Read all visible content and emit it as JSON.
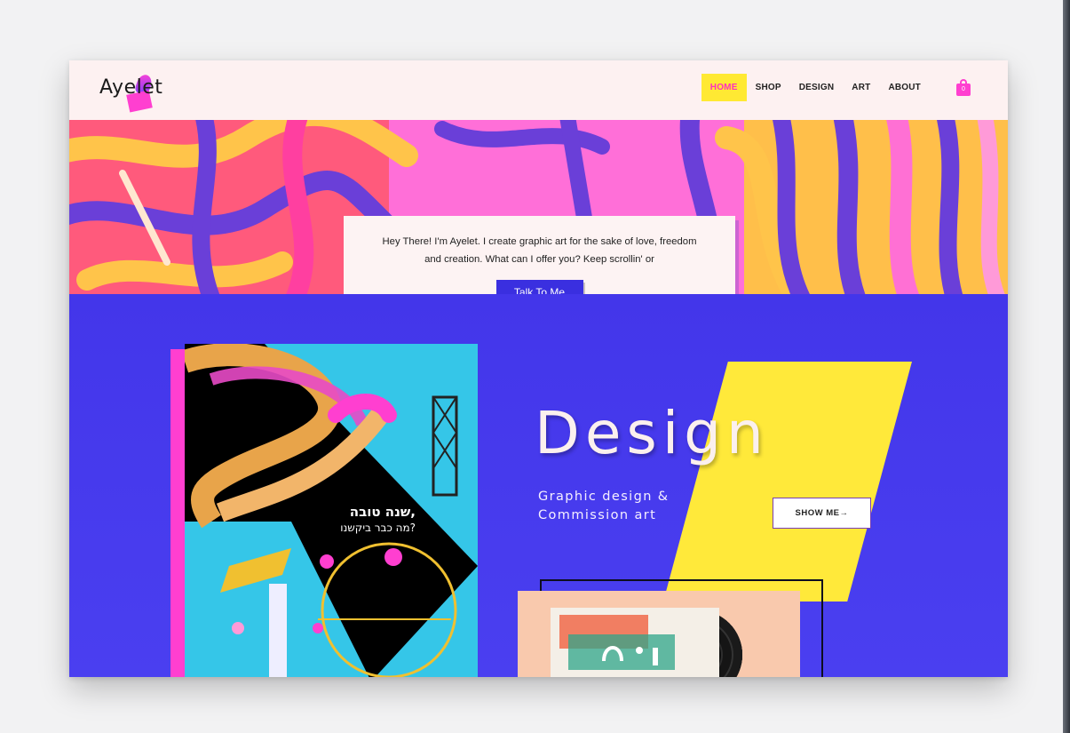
{
  "site": {
    "logo_text": "Ayelet",
    "logo_mark": "logo-flame-mark"
  },
  "nav": {
    "items": [
      {
        "label": "HOME",
        "active": true
      },
      {
        "label": "SHOP",
        "active": false
      },
      {
        "label": "DESIGN",
        "active": false
      },
      {
        "label": "ART",
        "active": false
      },
      {
        "label": "ABOUT",
        "active": false
      }
    ],
    "cart_icon": "shopping-bag-icon",
    "cart_count": "0"
  },
  "hero": {
    "intro_line1": "Hey There! I'm Ayelet. I create graphic art for the sake of love, freedom",
    "intro_line2": "and creation. What can I offer you? Keep scrollin' or",
    "cta_label": "Talk To Me"
  },
  "design": {
    "title": "Design",
    "subtitle_line1": "Graphic design &",
    "subtitle_line2": "Commission art",
    "button_label": "SHOW ME",
    "button_icon": "arrow-right-icon"
  },
  "poster": {
    "title_line1": "שנה טובה,",
    "title_line2": "מה כבר ביקשנו?"
  },
  "colors": {
    "accent_pink": "#ff3fd0",
    "accent_yellow": "#ffe933",
    "brand_blue": "#3a2fe0",
    "header_bg": "#fdf1f1",
    "section_blue": "#4537e8"
  }
}
